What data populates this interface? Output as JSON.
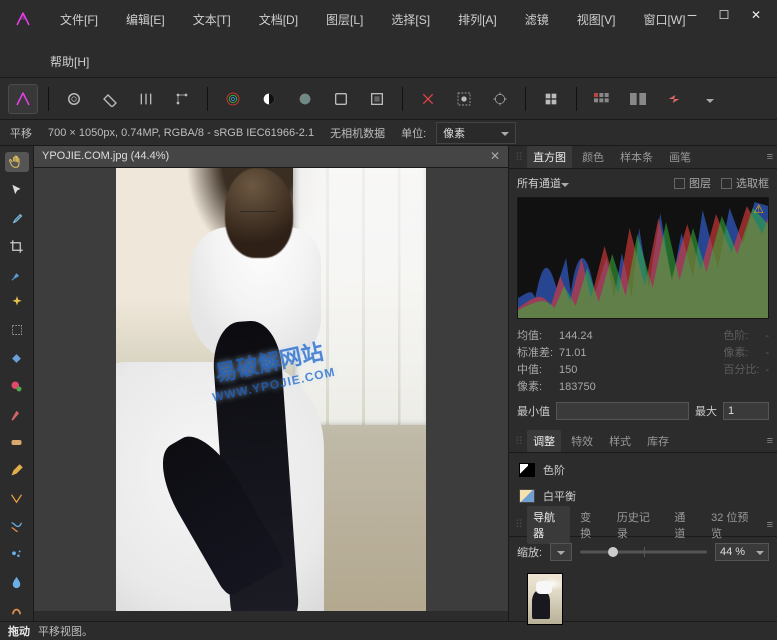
{
  "menu": [
    "文件[F]",
    "编辑[E]",
    "文本[T]",
    "文档[D]",
    "图层[L]",
    "选择[S]",
    "排列[A]",
    "滤镜",
    "视图[V]",
    "窗口[W]"
  ],
  "menu_help": "帮助[H]",
  "infobar": {
    "mode": "平移",
    "dims": "700 × 1050px, 0.74MP, RGBA/8 - sRGB IEC61966-2.1",
    "camera": "无相机数据",
    "unit_label": "单位:",
    "unit_value": "像素"
  },
  "doc_tab": "YPOJIE.COM.jpg (44.4%)",
  "watermark": {
    "line1": "易破解网站",
    "line2": "WWW.YPOJIE.COM"
  },
  "panels": {
    "histogram_tabs": [
      "直方图",
      "颜色",
      "样本条",
      "画笔"
    ],
    "channel_select": "所有通道",
    "check_layer": "图层",
    "check_sel": "选取框",
    "stats": {
      "mean_l": "均值:",
      "mean_v": "144.24",
      "std_l": "标准差:",
      "std_v": "71.01",
      "median_l": "中值:",
      "median_v": "150",
      "pixels_l": "像素:",
      "pixels_v": "183750",
      "r1_l": "色阶:",
      "r1_v": "-",
      "r2_l": "像素:",
      "r2_v": "-",
      "r3_l": "百分比:",
      "r3_v": "-"
    },
    "min_l": "最小值",
    "min_v": "",
    "max_l": "最大",
    "max_v": "1",
    "adjust_tabs": [
      "调整",
      "特效",
      "样式",
      "库存"
    ],
    "adj_items": [
      "色阶",
      "白平衡"
    ],
    "nav_tabs": [
      "导航器",
      "变换",
      "历史记录",
      "通道",
      "32 位预览"
    ],
    "zoom_l": "缩放:",
    "zoom_v": "44 %"
  },
  "status": {
    "b": "拖动",
    "rest": "平移视图。"
  },
  "left_tools": [
    "hand",
    "pointer",
    "eyedropper",
    "crop",
    "paintbrush",
    "sparkle",
    "marquee",
    "fill",
    "clone",
    "brush-alt",
    "patch",
    "pencil",
    "skew",
    "gradient",
    "splatter",
    "teardrop",
    "tear"
  ]
}
